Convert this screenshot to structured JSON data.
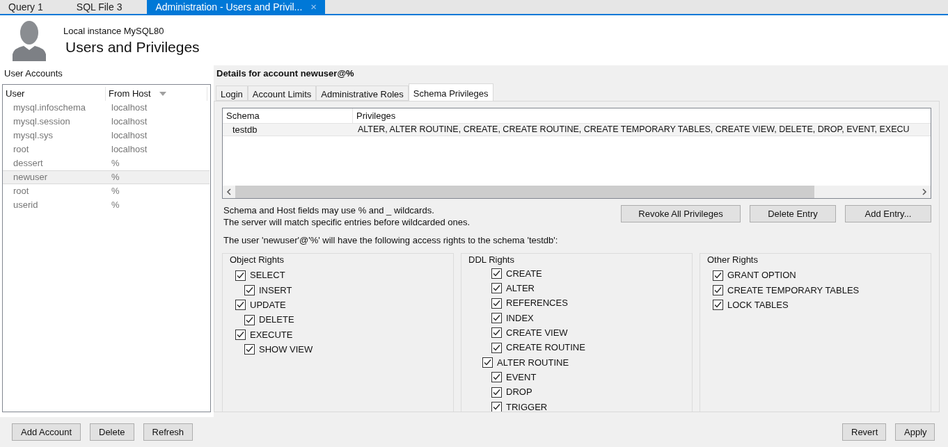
{
  "doc_tabs": [
    {
      "label": "Query 1",
      "selected": false
    },
    {
      "label": "SQL File 3",
      "selected": false
    },
    {
      "label": "Administration - Users and Privil...",
      "selected": true,
      "close": "×"
    }
  ],
  "header": {
    "subtitle": "Local instance MySQL80",
    "title": "Users and Privileges"
  },
  "accounts": {
    "title": "User Accounts",
    "columns": [
      "User",
      "From Host"
    ],
    "rows": [
      {
        "user": "mysql.infoschema",
        "host": "localhost",
        "selected": false
      },
      {
        "user": "mysql.session",
        "host": "localhost",
        "selected": false
      },
      {
        "user": "mysql.sys",
        "host": "localhost",
        "selected": false
      },
      {
        "user": "root",
        "host": "localhost",
        "selected": false
      },
      {
        "user": "dessert",
        "host": "%",
        "selected": false
      },
      {
        "user": "newuser",
        "host": "%",
        "selected": true
      },
      {
        "user": "root",
        "host": "%",
        "selected": false
      },
      {
        "user": "userid",
        "host": "%",
        "selected": false
      }
    ],
    "buttons": [
      "Add Account",
      "Delete",
      "Refresh"
    ]
  },
  "details": {
    "title": "Details for account newuser@%",
    "tabs": [
      {
        "label": "Login",
        "selected": false
      },
      {
        "label": "Account Limits",
        "selected": false
      },
      {
        "label": "Administrative Roles",
        "selected": false
      },
      {
        "label": "Schema Privileges",
        "selected": true
      }
    ],
    "table": {
      "columns": [
        "Schema",
        "Privileges"
      ],
      "rows": [
        {
          "schema": "testdb",
          "privileges": "ALTER, ALTER ROUTINE, CREATE, CREATE ROUTINE, CREATE TEMPORARY TABLES, CREATE VIEW, DELETE, DROP, EVENT, EXECU"
        }
      ]
    },
    "hint": [
      "Schema and Host fields may use % and _ wildcards.",
      "The server will match specific entries before wildcarded ones."
    ],
    "buttons": [
      "Revoke All Privileges",
      "Delete Entry",
      "Add Entry..."
    ],
    "access_note": "The user 'newuser'@'%' will have the following access rights to the schema 'testdb':",
    "groups": [
      {
        "title": "Object Rights",
        "items": [
          {
            "label": "SELECT",
            "checked": true,
            "kind": "top"
          },
          {
            "label": "INSERT",
            "checked": true,
            "kind": "sub"
          },
          {
            "label": "UPDATE",
            "checked": true,
            "kind": "top"
          },
          {
            "label": "DELETE",
            "checked": true,
            "kind": "sub"
          },
          {
            "label": "EXECUTE",
            "checked": true,
            "kind": "top"
          },
          {
            "label": "SHOW VIEW",
            "checked": true,
            "kind": "sub"
          }
        ]
      },
      {
        "title": "DDL Rights",
        "items": [
          {
            "label": "CREATE",
            "checked": true,
            "kind": "sub"
          },
          {
            "label": "ALTER",
            "checked": true,
            "kind": "sub"
          },
          {
            "label": "REFERENCES",
            "checked": true,
            "kind": "sub"
          },
          {
            "label": "INDEX",
            "checked": true,
            "kind": "sub"
          },
          {
            "label": "CREATE VIEW",
            "checked": true,
            "kind": "sub"
          },
          {
            "label": "CREATE ROUTINE",
            "checked": true,
            "kind": "sub"
          },
          {
            "label": "ALTER ROUTINE",
            "checked": true,
            "kind": "top"
          },
          {
            "label": "EVENT",
            "checked": true,
            "kind": "sub"
          },
          {
            "label": "DROP",
            "checked": true,
            "kind": "sub"
          },
          {
            "label": "TRIGGER",
            "checked": true,
            "kind": "sub"
          }
        ]
      },
      {
        "title": "Other Rights",
        "items": [
          {
            "label": "GRANT OPTION",
            "checked": true,
            "kind": "top"
          },
          {
            "label": "CREATE TEMPORARY TABLES",
            "checked": true,
            "kind": "top"
          },
          {
            "label": "LOCK TABLES",
            "checked": true,
            "kind": "top"
          }
        ]
      }
    ]
  },
  "footer_buttons": [
    "Revert",
    "Apply"
  ]
}
